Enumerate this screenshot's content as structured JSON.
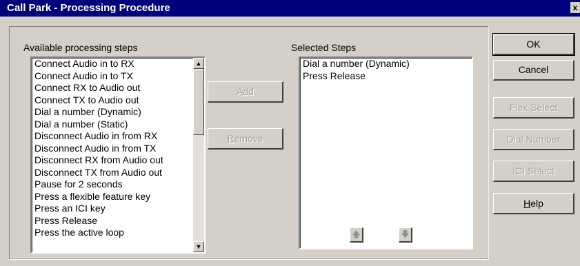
{
  "window": {
    "title": "Call Park - Processing Procedure",
    "close_glyph": "x"
  },
  "available": {
    "label": "Available processing steps",
    "items": [
      "Connect Audio in to RX",
      "Connect Audio in to TX",
      "Connect RX to Audio out",
      "Connect TX to Audio out",
      "Dial a number (Dynamic)",
      "Dial a number (Static)",
      "Disconnect Audio in from RX",
      "Disconnect Audio in from TX",
      "Disconnect RX from Audio out",
      "Disconnect TX from Audio out",
      "Pause for 2 seconds",
      "Press a flexible feature key",
      "Press an ICI key",
      "Press Release",
      "Press the active loop"
    ]
  },
  "selected": {
    "label": "Selected Steps",
    "items": [
      "Dial a number (Dynamic)",
      "Press Release"
    ]
  },
  "buttons": {
    "add_pre": "",
    "add_mnemonic": "A",
    "add_post": "dd",
    "remove_pre": "",
    "remove_mnemonic": "R",
    "remove_post": "emove",
    "ok": "OK",
    "cancel": "Cancel",
    "flex_select": "Flex Select",
    "dial_number": "Dial Number",
    "ici_select": "ICI Select",
    "help_pre": "",
    "help_mnemonic": "H",
    "help_post": "elp"
  },
  "icons": {
    "move_up": "up-arrow-icon",
    "move_down": "down-arrow-icon",
    "scroll_up": "scroll-up-icon",
    "scroll_down": "scroll-down-icon"
  }
}
